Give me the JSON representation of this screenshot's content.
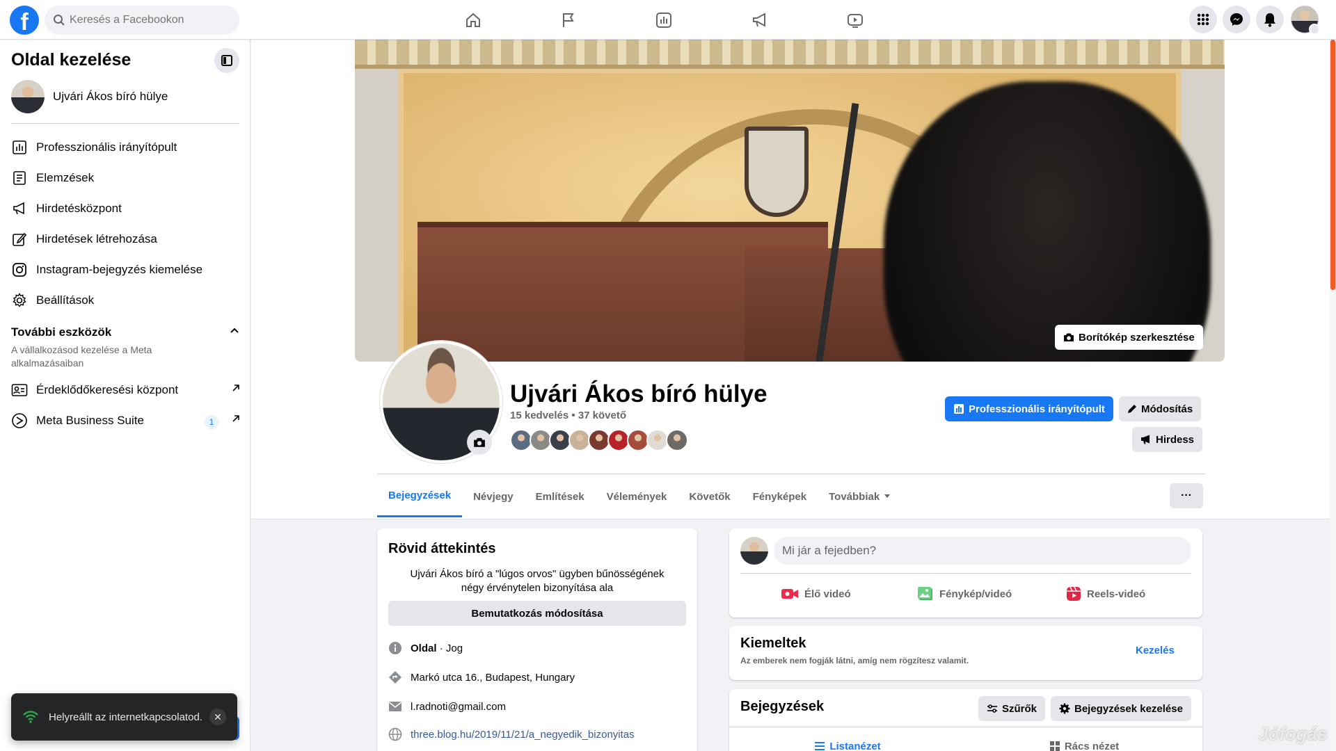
{
  "topnav": {
    "logo": "f",
    "search_placeholder": "Keresés a Facebookon",
    "center_icons": [
      "home-icon",
      "flag-icon",
      "insights-icon",
      "megaphone-icon",
      "video-icon"
    ],
    "right_icons": [
      "menu-grid-icon",
      "messenger-icon",
      "bell-icon"
    ]
  },
  "sidebar": {
    "title": "Oldal kezelése",
    "page_name": "Ujvári Ákos bíró hülye",
    "items": [
      {
        "label": "Professzionális irányítópult",
        "icon": "dashboard-icon"
      },
      {
        "label": "Elemzések",
        "icon": "insights-icon"
      },
      {
        "label": "Hirdetésközpont",
        "icon": "megaphone-icon"
      },
      {
        "label": "Hirdetések létrehozása",
        "icon": "pencil-icon"
      },
      {
        "label": "Instagram-bejegyzés kiemelése",
        "icon": "instagram-icon"
      },
      {
        "label": "Beállítások",
        "icon": "gear-icon"
      }
    ],
    "more_tools": {
      "title": "További eszközök",
      "subtitle": "A vállalkozásod kezelése a Meta alkalmazásaiban",
      "items": [
        {
          "label": "Érdeklődőkeresési központ",
          "icon": "leads-icon"
        },
        {
          "label": "Meta Business Suite",
          "icon": "meta-icon",
          "badge": "1"
        }
      ]
    }
  },
  "toast": {
    "message": "Helyreállt az internetkapcsolatod."
  },
  "cover": {
    "edit_label": "Borítókép szerkesztése"
  },
  "profile": {
    "name": "Ujvári Ákos bíró hülye",
    "stats": "15 kedvelés • 37 követő",
    "follower_avatar_colors": [
      "#5a6b82",
      "#8c8a86",
      "#3b3f49",
      "#c9b29a",
      "#7a3b2e",
      "#b8232a",
      "#a54c3c",
      "#e0dcd4",
      "#6e6b66"
    ],
    "buttons": {
      "dashboard": "Professzionális irányítópult",
      "edit": "Módosítás",
      "promote": "Hirdess"
    }
  },
  "tabs": [
    {
      "label": "Bejegyzések",
      "active": true
    },
    {
      "label": "Névjegy"
    },
    {
      "label": "Említések"
    },
    {
      "label": "Vélemények"
    },
    {
      "label": "Követők"
    },
    {
      "label": "Fényképek"
    },
    {
      "label": "Továbbiak"
    }
  ],
  "intro": {
    "title": "Rövid áttekintés",
    "bio": "Ujvári Ákos bíró a \"lúgos orvos\" ügyben bűnösségének négy érvénytelen bizonyítása ala",
    "edit_label": "Bemutatkozás módosítása",
    "category_prefix": "Oldal",
    "category": "· Jog",
    "address": "Markó utca 16., Budapest, Hungary",
    "email": "l.radnoti@gmail.com",
    "website": "three.blog.hu/2019/11/21/a_negyedik_bizonyitas"
  },
  "composer": {
    "placeholder": "Mi jár a fejedben?",
    "live": "Élő videó",
    "photo": "Fénykép/videó",
    "reels": "Reels-videó"
  },
  "featured": {
    "title": "Kiemeltek",
    "subtitle": "Az emberek nem fogják látni, amíg nem rögzítesz valamit.",
    "manage": "Kezelés"
  },
  "posts": {
    "title": "Bejegyzések",
    "filters": "Szűrők",
    "manage": "Bejegyzések kezelése",
    "list_view": "Listanézet",
    "grid_view": "Rács nézet"
  },
  "watermark": "Jófogás",
  "colors": {
    "brand": "#1877f2",
    "accent_scroll": "#f15a24"
  }
}
